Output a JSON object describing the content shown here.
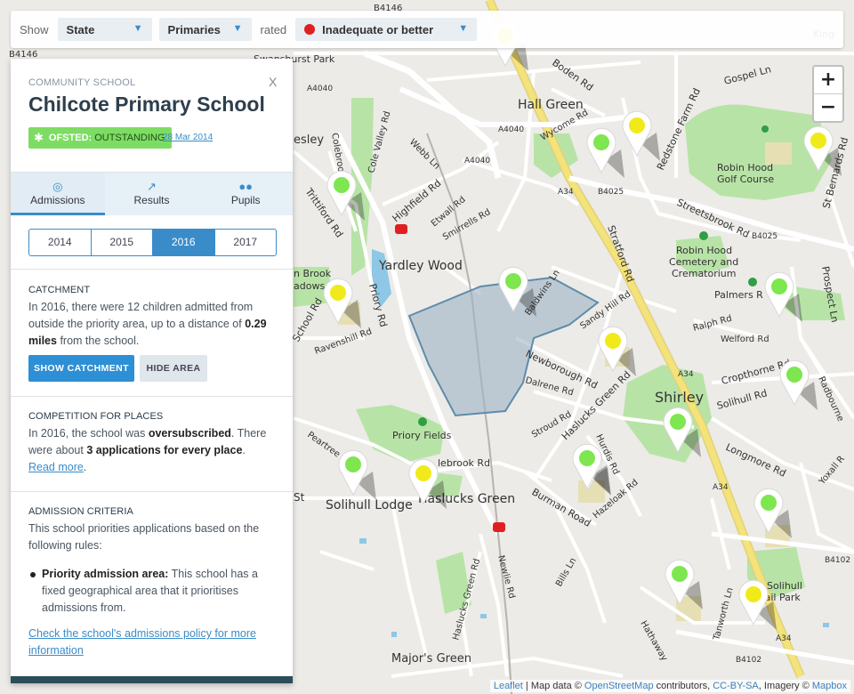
{
  "filter": {
    "show_label": "Show",
    "type_value": "State",
    "phase_value": "Primaries",
    "rated_label": "rated",
    "rating_value": "Inadequate or better",
    "rating_dot_color": "#e02020",
    "caret": "▼"
  },
  "zoom": {
    "in": "+",
    "out": "−"
  },
  "map": {
    "labels": {
      "b4146_top": "B4146",
      "b4146_left": "B4146",
      "swanshurst_park": "Swanshurst Park",
      "a4040_a": "A4040",
      "a4040_b": "A4040",
      "a4040_c": "A4040",
      "boden_rd": "Boden Rd",
      "gospel_ln": "Gospel Ln",
      "hall_green": "Hall Green",
      "wycome_rd": "Wycome Rd",
      "coleridge": "Colebrook",
      "cole_valley_rd": "Cole Valley Rd",
      "webb_ln": "Webb Ln",
      "esley": "esley",
      "redstone": "Redstone Farm Rd",
      "robin_hood_golf": "Robin Hood",
      "robin_hood_golf2": "Golf Course",
      "st_bernards": "St Bernards Rd",
      "trittiford_rd": "Trittiford Rd",
      "highfield_rd": "Highfield Rd",
      "etwall_rd": "Etwall Rd",
      "smirrells_rd": "Smirrells Rd",
      "a34_a": "A34",
      "b4025_a": "B4025",
      "streetsbrook": "Streetsbrook Rd",
      "b4025_b": "B4025",
      "stratford_rd": "Stratford Rd",
      "yardley_wood": "Yardley Wood",
      "robin_hood_cem1": "Robin Hood",
      "robin_hood_cem2": "Cemetery and",
      "robin_hood_cem3": "Crematorium",
      "palmers": "Palmers R",
      "prospect_ln": "Prospect Ln",
      "brook1": "n Brook",
      "brook2": "adows",
      "school_rd": "School Rd",
      "priory_rd": "Priory Rd",
      "ravenshill": "Ravenshill Rd",
      "baldwins_ln": "Baldwins Ln",
      "sandy_hill": "Sandy Hill Rd",
      "ralph_rd": "Ralph Rd",
      "welford_rd": "Welford Rd",
      "newborough_rd": "Newborough Rd",
      "dalrene_rd": "Dalrene Rd",
      "a34_b": "A34",
      "shirley": "Shirley",
      "cropthorne": "Cropthorne Rd",
      "radbourne": "Radbourne",
      "solihull_rd": "Solihull Rd",
      "haslucks_green_rd": "Haslucks Green Rd",
      "stroud_rd": "Stroud Rd",
      "priory_fields": "Priory Fields",
      "peartree": "Peartree",
      "hurdis_rd": "Hurdis Rd",
      "longmore_rd": "Longmore Rd",
      "yoxall": "Yoxall R",
      "lebrook_rd": "lebrook Rd",
      "st": "St",
      "solihull_lodge": "Solihull Lodge",
      "haslucks_green": "Haslucks Green",
      "burman_road": "Burman Road",
      "hazeloak_rd": "Hazeloak Rd",
      "a34_c": "A34",
      "newlie_rd": "Newlie Rd",
      "haslucks_green_rd2": "Haslucks Green Rd",
      "bills_ln": "Bills Ln",
      "b4102_a": "B4102",
      "solihull_park1": "Solihull",
      "solihull_park2": "Trail Park",
      "hathaway": "Hathaway",
      "tanworth_ln": "Tanworth Ln",
      "a34_d": "A34",
      "b4102_b": "B4102",
      "majors_green": "Major's Green",
      "king": "King"
    },
    "markers": [
      {
        "color": "green"
      },
      {
        "color": "yellow"
      },
      {
        "color": "green"
      },
      {
        "color": "yellow"
      },
      {
        "color": "green"
      },
      {
        "color": "yellow"
      },
      {
        "color": "green"
      },
      {
        "color": "green"
      },
      {
        "color": "green"
      },
      {
        "color": "green"
      },
      {
        "color": "yellow"
      },
      {
        "color": "green"
      },
      {
        "color": "yellow"
      },
      {
        "color": "green"
      },
      {
        "color": "green"
      },
      {
        "color": "yellow"
      },
      {
        "color": "green"
      },
      {
        "color": "yellow"
      }
    ]
  },
  "panel": {
    "type": "COMMUNITY SCHOOL",
    "close": "X",
    "title": "Chilcote Primary School",
    "ofsted_label": "OFSTED:",
    "ofsted_rating": "OUTSTANDING",
    "ofsted_date": "28 Mar 2014",
    "tabs": [
      {
        "label": "Admissions",
        "icon": "target-icon"
      },
      {
        "label": "Results",
        "icon": "trend-icon"
      },
      {
        "label": "Pupils",
        "icon": "people-icon"
      }
    ],
    "years": [
      "2014",
      "2015",
      "2016",
      "2017"
    ],
    "active_year": "2016",
    "catchment": {
      "heading": "CATCHMENT",
      "text_a": "In 2016, there were 12 children admitted from outside the priority area, up to a distance of ",
      "distance": "0.29 miles",
      "text_b": " from the school.",
      "show_btn": "SHOW CATCHMENT",
      "hide_btn": "HIDE AREA"
    },
    "competition": {
      "heading": "COMPETITION FOR PLACES",
      "text_a": "In 2016, the school was ",
      "status": "oversubscribed",
      "text_b": ". There were about ",
      "apps": "3 applications for every place",
      "text_c": ".",
      "read_more": "Read more"
    },
    "criteria": {
      "heading": "ADMISSION CRITERIA",
      "intro": "This school priorities applications based on the following rules:",
      "rule_title": "Priority admission area:",
      "rule_text": " This school has a fixed geographical area that it prioritises admissions from.",
      "policy_link": "Check the school's admissions policy for more information"
    }
  },
  "attribution": {
    "leaflet": "Leaflet",
    "sep1": " | Map data © ",
    "osm": "OpenStreetMap",
    "sep2": " contributors, ",
    "cc": "CC-BY-SA",
    "sep3": ", Imagery © ",
    "mapbox": "Mapbox"
  }
}
